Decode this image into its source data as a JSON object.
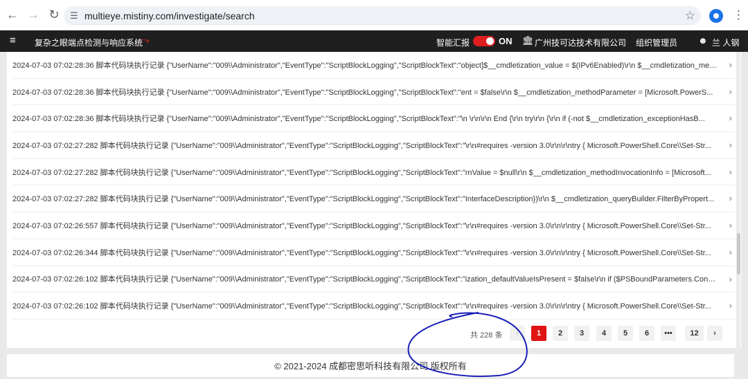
{
  "browser": {
    "url": "multieye.mistiny.com/investigate/search"
  },
  "header": {
    "app_title": "复杂之眼端点检测与响应系统",
    "smart_report_label": "智能汇报",
    "toggle_state": "ON",
    "company": "广州技可达技术有限公司",
    "org_management": "组织管理员",
    "user": "兰 人钢"
  },
  "logs": [
    "2024-07-03 07:02:28:36 脚本代码块执行记录 {\"UserName\":\"009\\\\Administrator\",\"EventType\":\"ScriptBlockLogging\",\"ScriptBlockText\":\"object]$__cmdletization_value = $(IPv6Enabled)\\r\\n $__cmdletization_met...",
    "2024-07-03 07:02:28:36 脚本代码块执行记录 {\"UserName\":\"009\\\\Administrator\",\"EventType\":\"ScriptBlockLogging\",\"ScriptBlockText\":\"ent = $false\\r\\n $__cmdletization_methodParameter = [Microsoft.PowerS...",
    "2024-07-03 07:02:28:36 脚本代码块执行记录 {\"UserName\":\"009\\\\Administrator\",\"EventType\":\"ScriptBlockLogging\",\"ScriptBlockText\":\"\\n \\r\\n\\r\\n End {\\r\\n try\\r\\n {\\r\\n if (-not $__cmdletization_exceptionHasB...",
    "2024-07-03 07:02:27:282 脚本代码块执行记录 {\"UserName\":\"009\\\\Administrator\",\"EventType\":\"ScriptBlockLogging\",\"ScriptBlockText\":\"\\r\\n#requires -version 3.0\\r\\n\\r\\ntry { Microsoft.PowerShell.Core\\\\Set-Str...",
    "2024-07-03 07:02:27:282 脚本代码块执行记录 {\"UserName\":\"009\\\\Administrator\",\"EventType\":\"ScriptBlockLogging\",\"ScriptBlockText\":\"rnValue = $null\\r\\n $__cmdletization_methodInvocationInfo = [Microsoft...",
    "2024-07-03 07:02:27:282 脚本代码块执行记录 {\"UserName\":\"009\\\\Administrator\",\"EventType\":\"ScriptBlockLogging\",\"ScriptBlockText\":\"InterfaceDescription})\\r\\n $__cmdletization_queryBuilder.FilterByPropert...",
    "2024-07-03 07:02:26:557 脚本代码块执行记录 {\"UserName\":\"009\\\\Administrator\",\"EventType\":\"ScriptBlockLogging\",\"ScriptBlockText\":\"\\r\\n#requires -version 3.0\\r\\n\\r\\ntry { Microsoft.PowerShell.Core\\\\Set-Str...",
    "2024-07-03 07:02:26:344 脚本代码块执行记录 {\"UserName\":\"009\\\\Administrator\",\"EventType\":\"ScriptBlockLogging\",\"ScriptBlockText\":\"\\r\\n#requires -version 3.0\\r\\n\\r\\ntry { Microsoft.PowerShell.Core\\\\Set-Str...",
    "2024-07-03 07:02:26:102 脚本代码块执行记录 {\"UserName\":\"009\\\\Administrator\",\"EventType\":\"ScriptBlockLogging\",\"ScriptBlockText\":\"ization_defaultValueIsPresent = $false\\r\\n if ($PSBoundParameters.Conta...",
    "2024-07-03 07:02:26:102 脚本代码块执行记录 {\"UserName\":\"009\\\\Administrator\",\"EventType\":\"ScriptBlockLogging\",\"ScriptBlockText\":\"\\r\\n#requires -version 3.0\\r\\n\\r\\ntry { Microsoft.PowerShell.Core\\\\Set-Str..."
  ],
  "pagination": {
    "total": "共 228 条",
    "pages": [
      "1",
      "2",
      "3",
      "4",
      "5",
      "6",
      "•••",
      "12"
    ],
    "current": "1"
  },
  "footer": {
    "copyright": "© 2021-2024 成都密思听科技有限公司 版权所有"
  },
  "colors": {
    "accent": "#e01414",
    "header_bg": "#1f1f1f",
    "annotation": "#1a1fb8"
  }
}
